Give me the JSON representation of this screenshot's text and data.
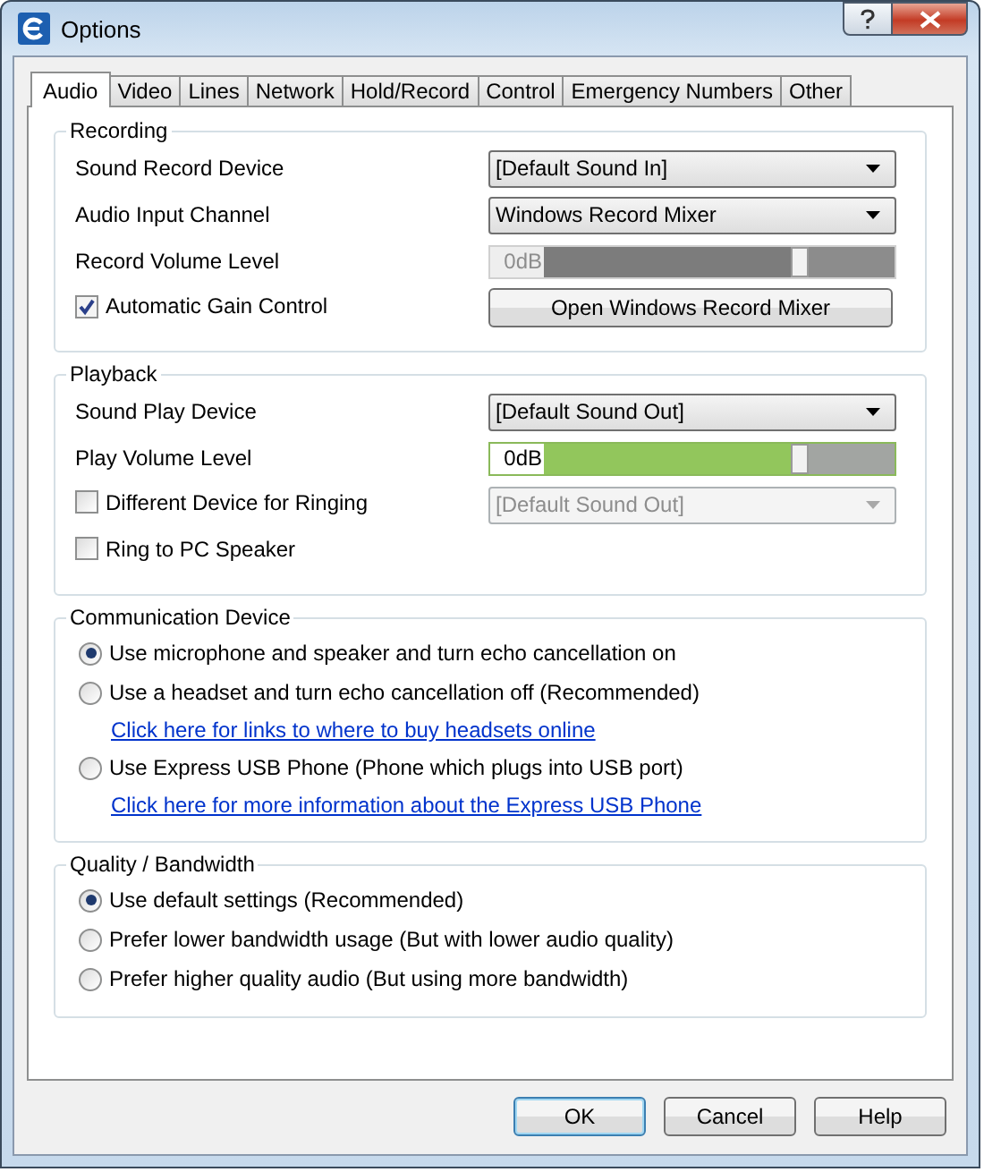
{
  "window": {
    "title": "Options"
  },
  "tabs": [
    {
      "label": "Audio",
      "selected": true
    },
    {
      "label": "Video",
      "selected": false
    },
    {
      "label": "Lines",
      "selected": false
    },
    {
      "label": "Network",
      "selected": false
    },
    {
      "label": "Hold/Record",
      "selected": false
    },
    {
      "label": "Control",
      "selected": false
    },
    {
      "label": "Emergency Numbers",
      "selected": false
    },
    {
      "label": "Other",
      "selected": false
    }
  ],
  "groups": [
    {
      "title": "Recording",
      "kind": "form",
      "rows": [
        {
          "left": {
            "kind": "label",
            "text": "Sound Record Device"
          },
          "right": {
            "kind": "dropdown",
            "value": "[Default Sound In]",
            "disabled": false
          }
        },
        {
          "left": {
            "kind": "label",
            "text": "Audio Input Channel"
          },
          "right": {
            "kind": "dropdown",
            "value": "Windows Record Mixer",
            "disabled": false
          }
        },
        {
          "left": {
            "kind": "label",
            "text": "Record Volume Level"
          },
          "right": {
            "kind": "slider",
            "reading": "0dB",
            "level": 0.78,
            "disabled": true
          }
        },
        {
          "left": {
            "kind": "checkbox",
            "text": "Automatic Gain Control",
            "checked": true
          },
          "right": {
            "kind": "button",
            "text": "Open Windows Record Mixer"
          }
        }
      ]
    },
    {
      "title": "Playback",
      "kind": "form",
      "rows": [
        {
          "left": {
            "kind": "label",
            "text": "Sound Play Device"
          },
          "right": {
            "kind": "dropdown",
            "value": "[Default Sound Out]",
            "disabled": false
          }
        },
        {
          "left": {
            "kind": "label",
            "text": "Play Volume Level"
          },
          "right": {
            "kind": "slider",
            "reading": "0dB",
            "level": 0.78,
            "disabled": false
          }
        },
        {
          "left": {
            "kind": "checkbox",
            "text": "Different Device for Ringing",
            "checked": false
          },
          "right": {
            "kind": "dropdown",
            "value": "[Default Sound Out]",
            "disabled": true
          }
        },
        {
          "left": {
            "kind": "checkbox",
            "text": "Ring to PC Speaker",
            "checked": false
          }
        }
      ]
    },
    {
      "title": "Communication Device",
      "kind": "options",
      "items": [
        {
          "kind": "radio",
          "text": "Use microphone and speaker and turn echo cancellation on",
          "selected": true
        },
        {
          "kind": "radio",
          "text": "Use a headset and turn echo cancellation off (Recommended)",
          "selected": false
        },
        {
          "kind": "link",
          "text": "Click here for links to where to buy headsets online"
        },
        {
          "kind": "radio",
          "text": "Use Express USB Phone (Phone which plugs into USB port)",
          "selected": false
        },
        {
          "kind": "link",
          "text": "Click here for more information about the Express USB Phone"
        }
      ]
    },
    {
      "title": "Quality / Bandwidth",
      "kind": "options",
      "items": [
        {
          "kind": "radio",
          "text": "Use default settings (Recommended)",
          "selected": true
        },
        {
          "kind": "radio",
          "text": "Prefer lower bandwidth usage (But with lower audio quality)",
          "selected": false
        },
        {
          "kind": "radio",
          "text": "Prefer higher quality audio (But using more bandwidth)",
          "selected": false
        }
      ]
    }
  ],
  "buttons": [
    {
      "text": "OK",
      "default": true
    },
    {
      "text": "Cancel",
      "default": false
    },
    {
      "text": "Help",
      "default": false
    }
  ]
}
